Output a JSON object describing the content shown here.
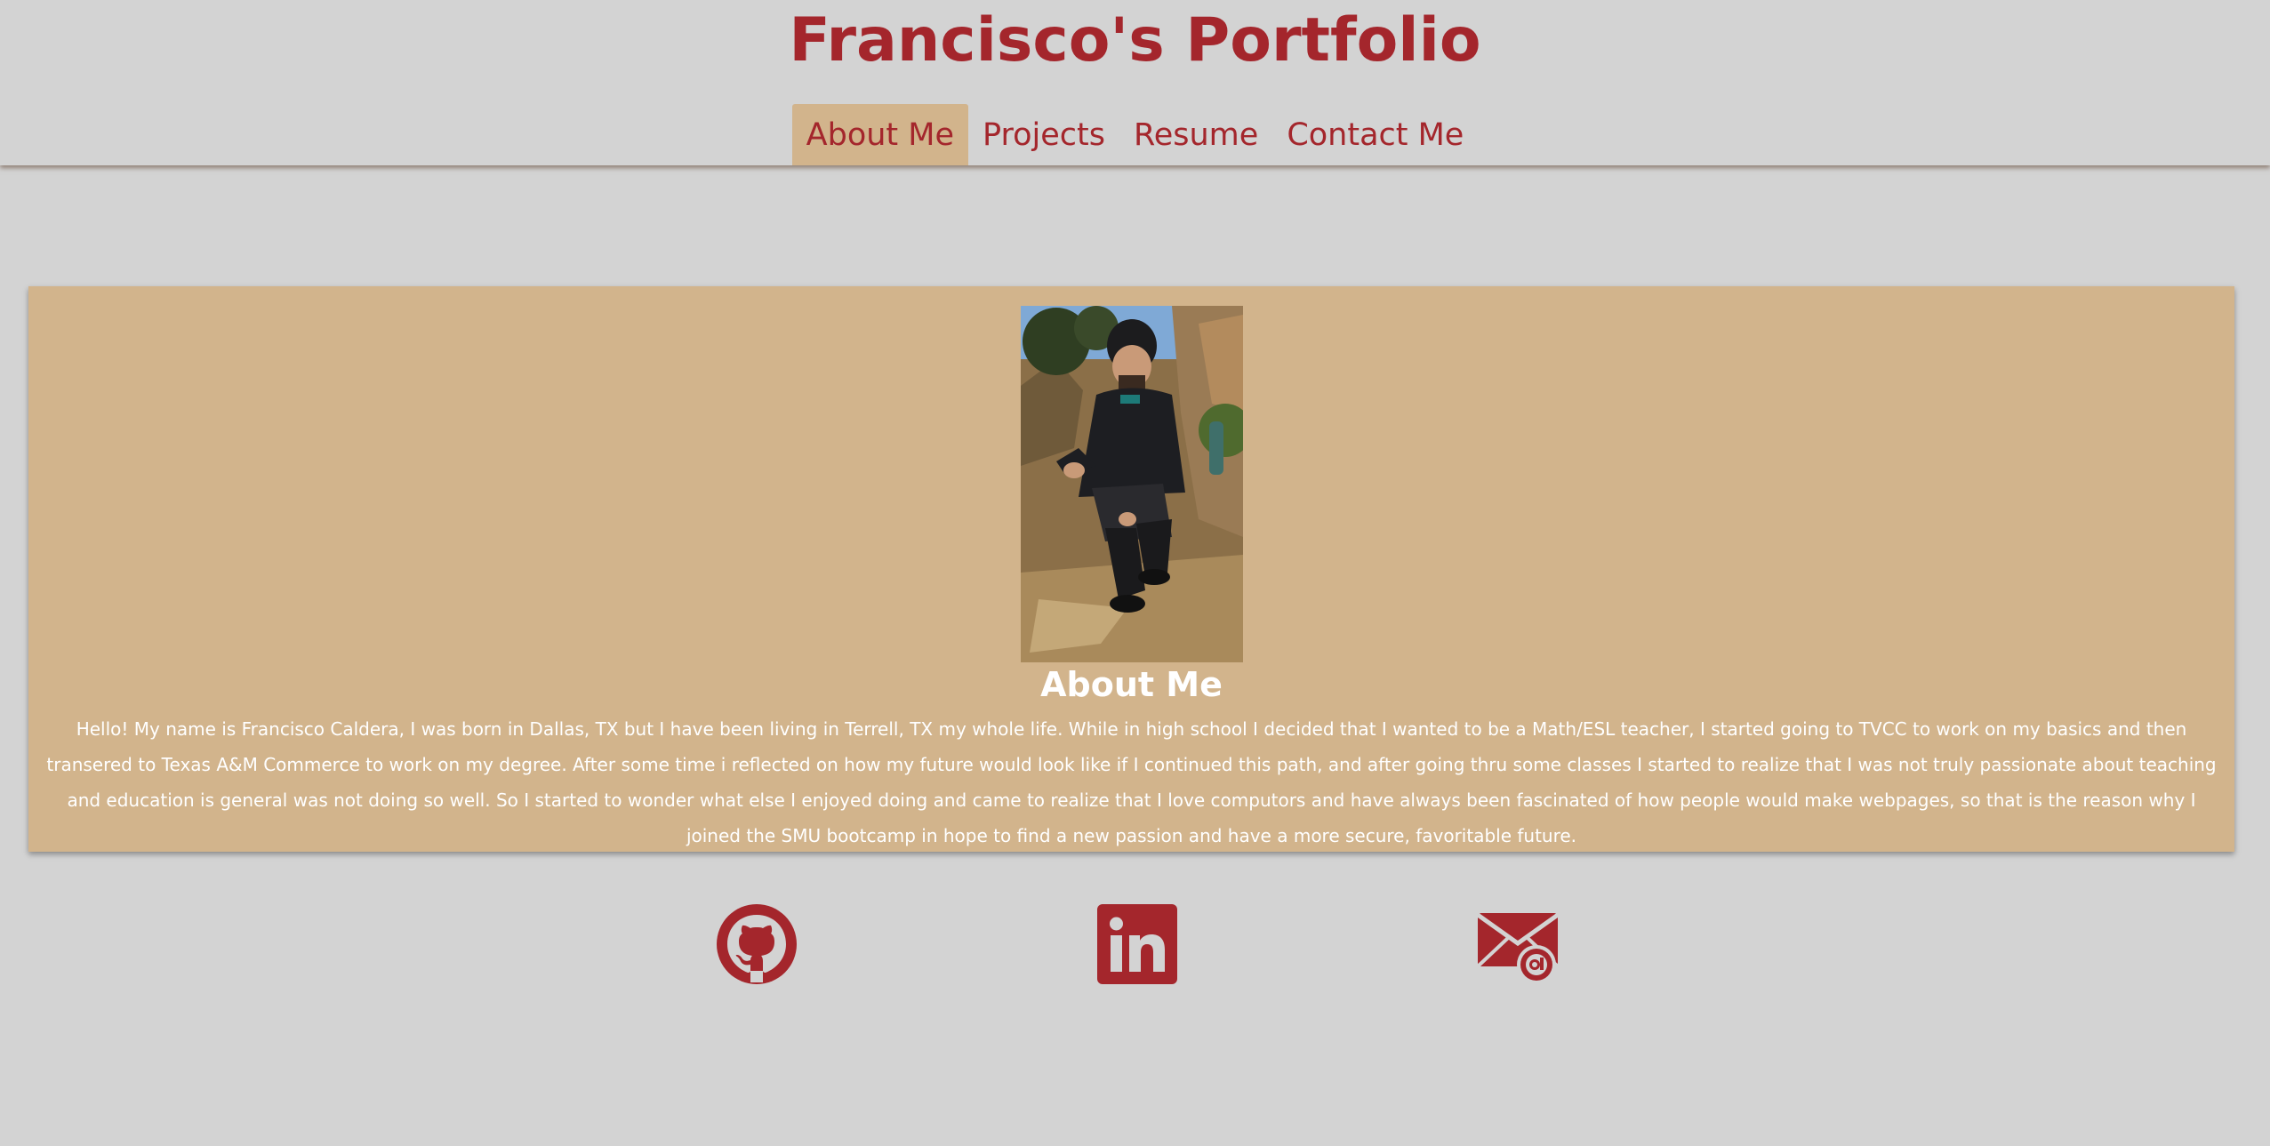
{
  "header": {
    "title": "Francisco's Portfolio"
  },
  "nav": {
    "items": [
      {
        "label": "About Me",
        "active": true
      },
      {
        "label": "Projects",
        "active": false
      },
      {
        "label": "Resume",
        "active": false
      },
      {
        "label": "Contact Me",
        "active": false
      }
    ]
  },
  "about": {
    "photo": "profile-photo",
    "heading": "About Me",
    "text": "Hello! My name is Francisco Caldera, I was born in Dallas, TX but I have been living in Terrell, TX my whole life. While in high school I decided that I wanted to be a Math/ESL teacher, I started going to TVCC to work on my basics and then transered to Texas A&M Commerce to work on my degree. After some time i reflected on how my future would look like if I continued this path, and after going thru some classes I started to realize that I was not truly passionate about teaching and education is general was not doing so well. So I started to wonder what else I enjoyed doing and came to realize that I love computors and have always been fascinated of how people would make webpages, so that is the reason why I joined the SMU bootcamp in hope to find a new passion and have a more secure, favoritable future."
  },
  "social": {
    "links": [
      {
        "icon": "github-icon"
      },
      {
        "icon": "linkedin-icon"
      },
      {
        "icon": "email-icon"
      }
    ]
  },
  "colors": {
    "background": "#d3d3d3",
    "accent": "#a4262c",
    "card": "#d2b48c",
    "text_on_card": "#ffffff"
  }
}
